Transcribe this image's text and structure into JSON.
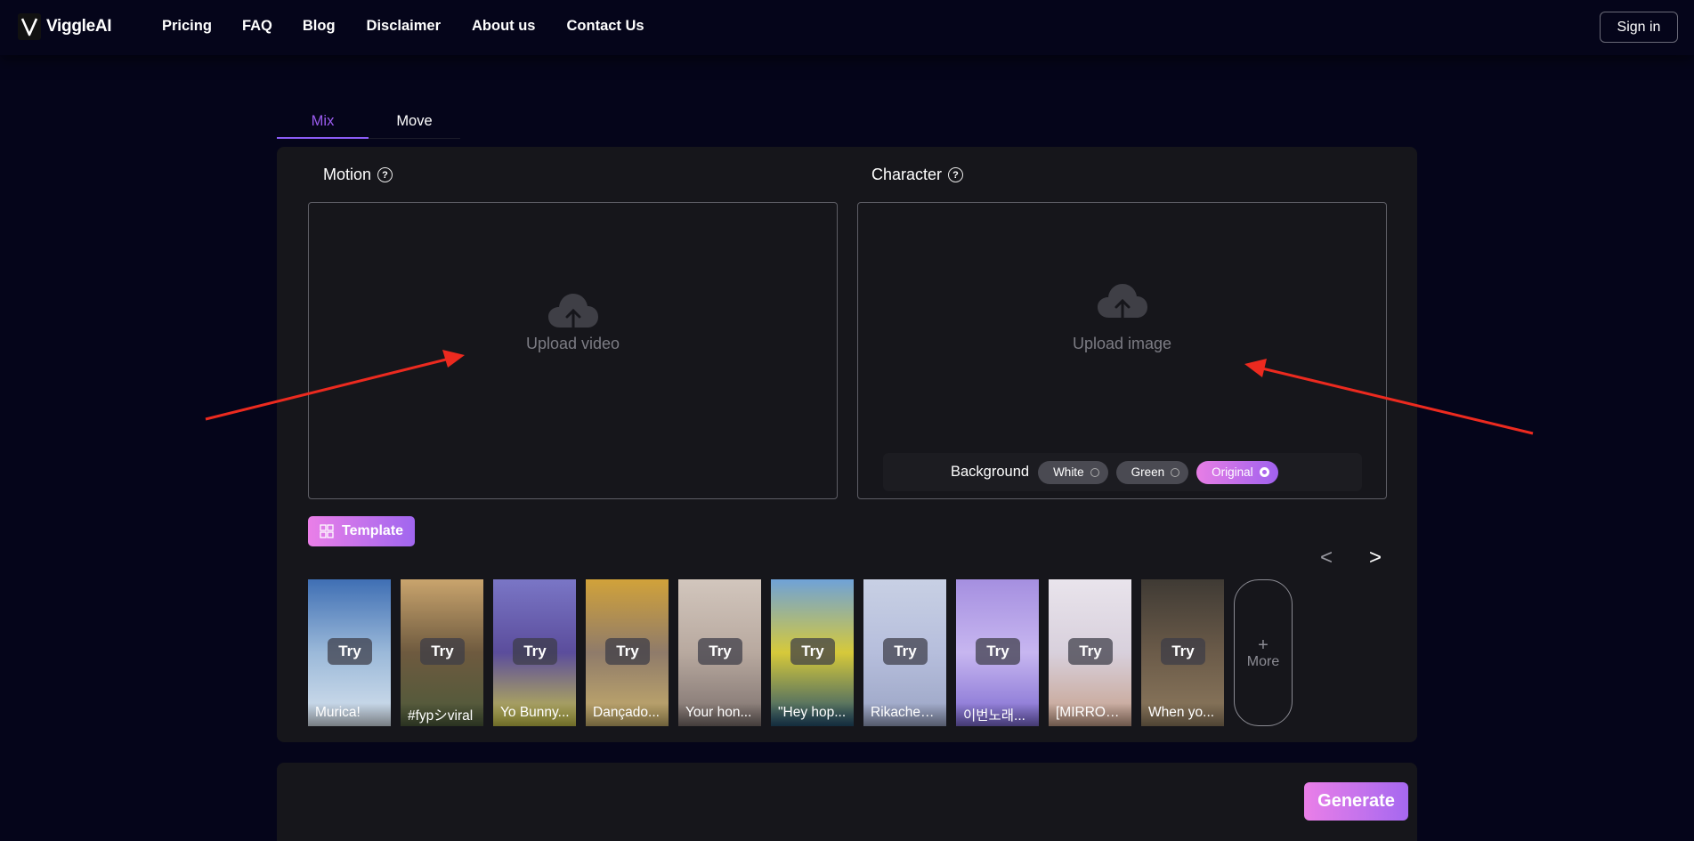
{
  "brand": {
    "name": "ViggleAI",
    "logo_icon": "viggle-v-logo-icon"
  },
  "nav": {
    "items": [
      "Pricing",
      "FAQ",
      "Blog",
      "Disclaimer",
      "About us",
      "Contact Us"
    ],
    "signin_label": "Sign in"
  },
  "tabs": [
    {
      "label": "Mix",
      "active": true
    },
    {
      "label": "Move",
      "active": false
    }
  ],
  "motion": {
    "label": "Motion",
    "help_icon": "help-circle-icon",
    "upload_text": "Upload video",
    "upload_icon": "cloud-upload-icon"
  },
  "character": {
    "label": "Character",
    "help_icon": "help-circle-icon",
    "upload_text": "Upload image",
    "upload_icon": "cloud-upload-icon"
  },
  "background": {
    "label": "Background",
    "options": [
      {
        "label": "White",
        "selected": false
      },
      {
        "label": "Green",
        "selected": false
      },
      {
        "label": "Original",
        "selected": true
      }
    ]
  },
  "template": {
    "label": "Template",
    "icon": "grid-icon"
  },
  "carousel": {
    "prev": "<",
    "next": ">"
  },
  "templates": [
    {
      "try": "Try",
      "caption": "Murica!",
      "colors": [
        "#3f6fb4",
        "#9bb9d9",
        "#d8e3ee"
      ]
    },
    {
      "try": "Try",
      "caption": "#fypシviral",
      "colors": [
        "#c9a46d",
        "#6e5a3f",
        "#4c5a3a"
      ]
    },
    {
      "try": "Try",
      "caption": "Yo Bunny...",
      "colors": [
        "#7a76c6",
        "#5b4d9c",
        "#c7c24a"
      ]
    },
    {
      "try": "Try",
      "caption": "Dançado...",
      "colors": [
        "#d1a23a",
        "#8f7b6a",
        "#c9b06c"
      ]
    },
    {
      "try": "Try",
      "caption": "Your hon...",
      "colors": [
        "#d2c6bd",
        "#b8a99f",
        "#7b6f6c"
      ]
    },
    {
      "try": "Try",
      "caption": "\"Hey hop...",
      "colors": [
        "#6fa2d8",
        "#d6c93a",
        "#24506f"
      ]
    },
    {
      "try": "Try",
      "caption": "Rikachew...",
      "colors": [
        "#c8d0e4",
        "#b6bedc",
        "#9aa4c4"
      ]
    },
    {
      "try": "Try",
      "caption": "이번노래...",
      "colors": [
        "#a58fe0",
        "#c7b6f0",
        "#7d6ad0"
      ]
    },
    {
      "try": "Try",
      "caption": "[MIRROR...",
      "colors": [
        "#e9e4ec",
        "#d8d0dc",
        "#c59f8a"
      ]
    },
    {
      "try": "Try",
      "caption": "When yo...",
      "colors": [
        "#3f3a34",
        "#6b5b49",
        "#8e7a5e"
      ]
    }
  ],
  "more": {
    "plus": "+",
    "label": "More"
  },
  "generate": {
    "label": "Generate"
  },
  "annotations": {
    "arrow_color": "#ec2a1f"
  }
}
